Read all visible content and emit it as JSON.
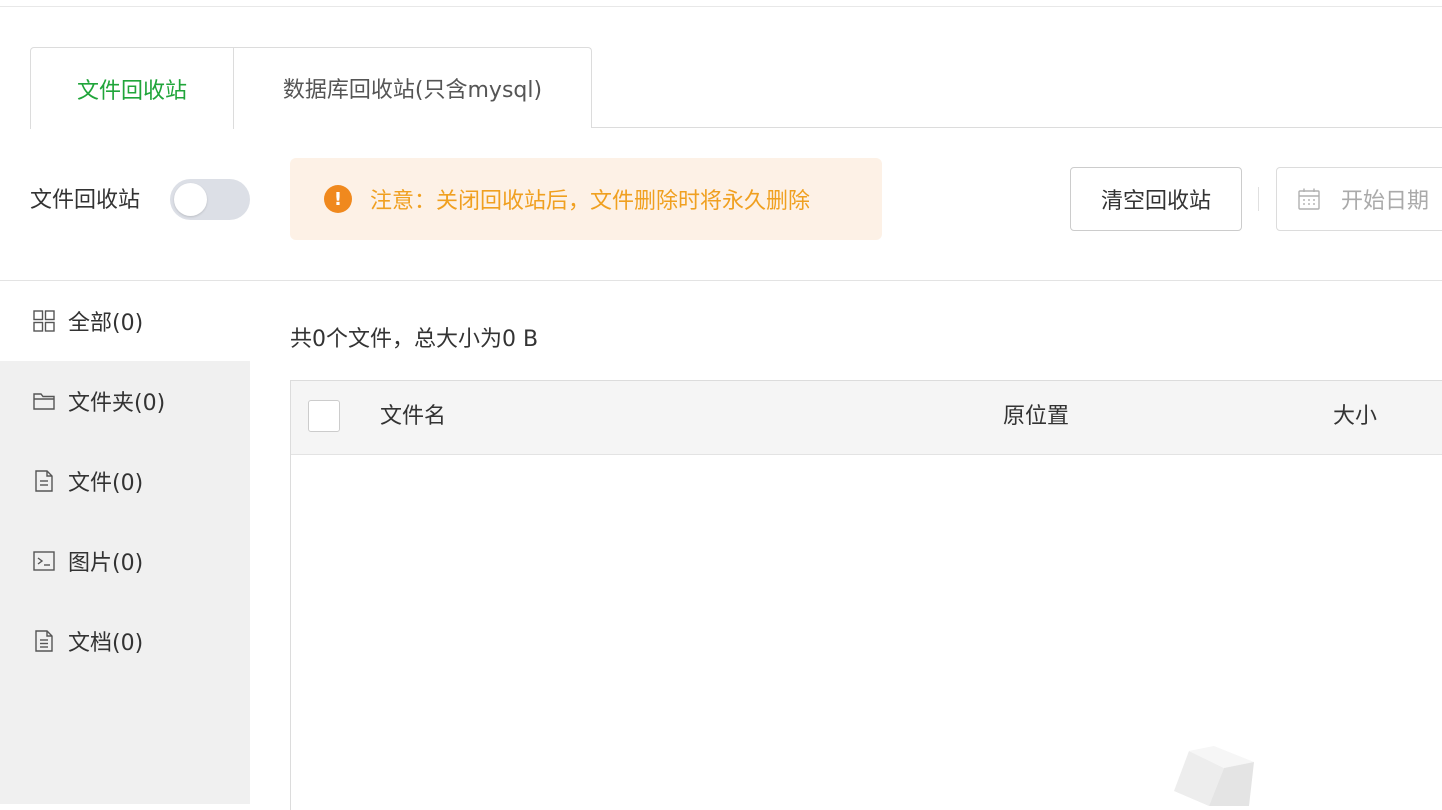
{
  "tabs": [
    {
      "label": "文件回收站",
      "active": true
    },
    {
      "label": "数据库回收站(只含mysql)",
      "active": false
    }
  ],
  "toolbar": {
    "recycle_label": "文件回收站",
    "toggle_on": false,
    "notice_text": "注意：关闭回收站后，文件删除时将永久删除",
    "notice_icon": "!",
    "clear_button": "清空回收站",
    "start_date_placeholder": "开始日期"
  },
  "sidebar": {
    "items": [
      {
        "label": "全部(0)",
        "icon": "grid-icon"
      },
      {
        "label": "文件夹(0)",
        "icon": "folder-icon"
      },
      {
        "label": "文件(0)",
        "icon": "file-icon"
      },
      {
        "label": "图片(0)",
        "icon": "image-icon"
      },
      {
        "label": "文档(0)",
        "icon": "document-icon"
      }
    ]
  },
  "main": {
    "summary": "共0个文件，总大小为0 B",
    "columns": [
      "文件名",
      "原位置",
      "大小"
    ],
    "rows": []
  },
  "colors": {
    "accent": "#20a53a",
    "notice_bg": "#fdf1e6",
    "notice_text": "#f0a020",
    "notice_icon": "#f0891e"
  }
}
